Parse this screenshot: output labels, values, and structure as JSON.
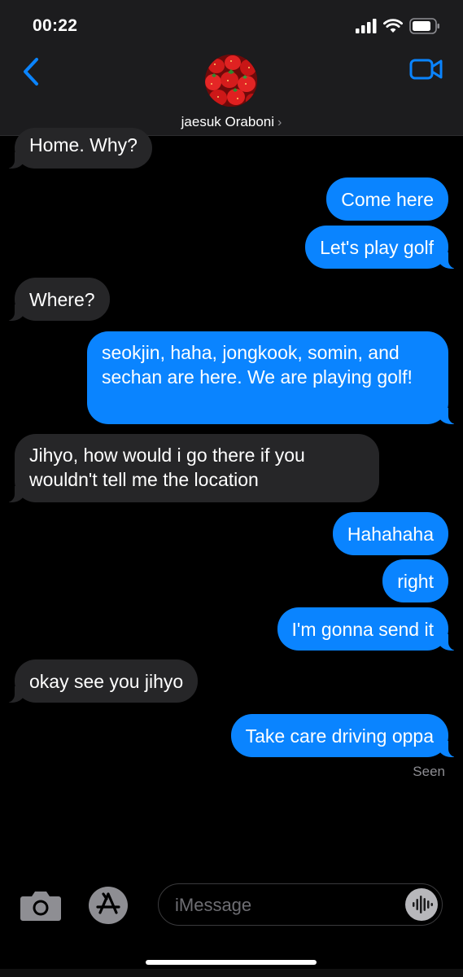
{
  "status_bar": {
    "time": "00:22"
  },
  "header": {
    "contact_name": "jaesuk Oraboni",
    "chevron": "›"
  },
  "messages": [
    {
      "from": "them",
      "text": "Home. Why?"
    },
    {
      "from": "me",
      "text": "Come here"
    },
    {
      "from": "me",
      "text": "Let's play golf"
    },
    {
      "from": "them",
      "text": "Where?"
    },
    {
      "from": "me",
      "text": "seokjin, haha, jongkook, somin, and sechan are here. We are playing golf!"
    },
    {
      "from": "them",
      "text": "Jihyo, how would i go there if you wouldn't tell me the location"
    },
    {
      "from": "me",
      "text": "Hahahaha"
    },
    {
      "from": "me",
      "text": "right"
    },
    {
      "from": "me",
      "text": "I'm gonna send it"
    },
    {
      "from": "them",
      "text": "okay see you jihyo"
    },
    {
      "from": "me",
      "text": "Take care driving oppa"
    }
  ],
  "read_receipt": "Seen",
  "composer": {
    "placeholder": "iMessage"
  },
  "icons": {
    "back": "chevron-left-icon",
    "video": "video-camera-icon",
    "camera": "camera-icon",
    "apps": "app-store-icon",
    "audio": "waveform-icon"
  },
  "colors": {
    "sent_bubble": "#0a84ff",
    "received_bubble": "#262628",
    "accent": "#0a84ff",
    "background": "#000000"
  }
}
